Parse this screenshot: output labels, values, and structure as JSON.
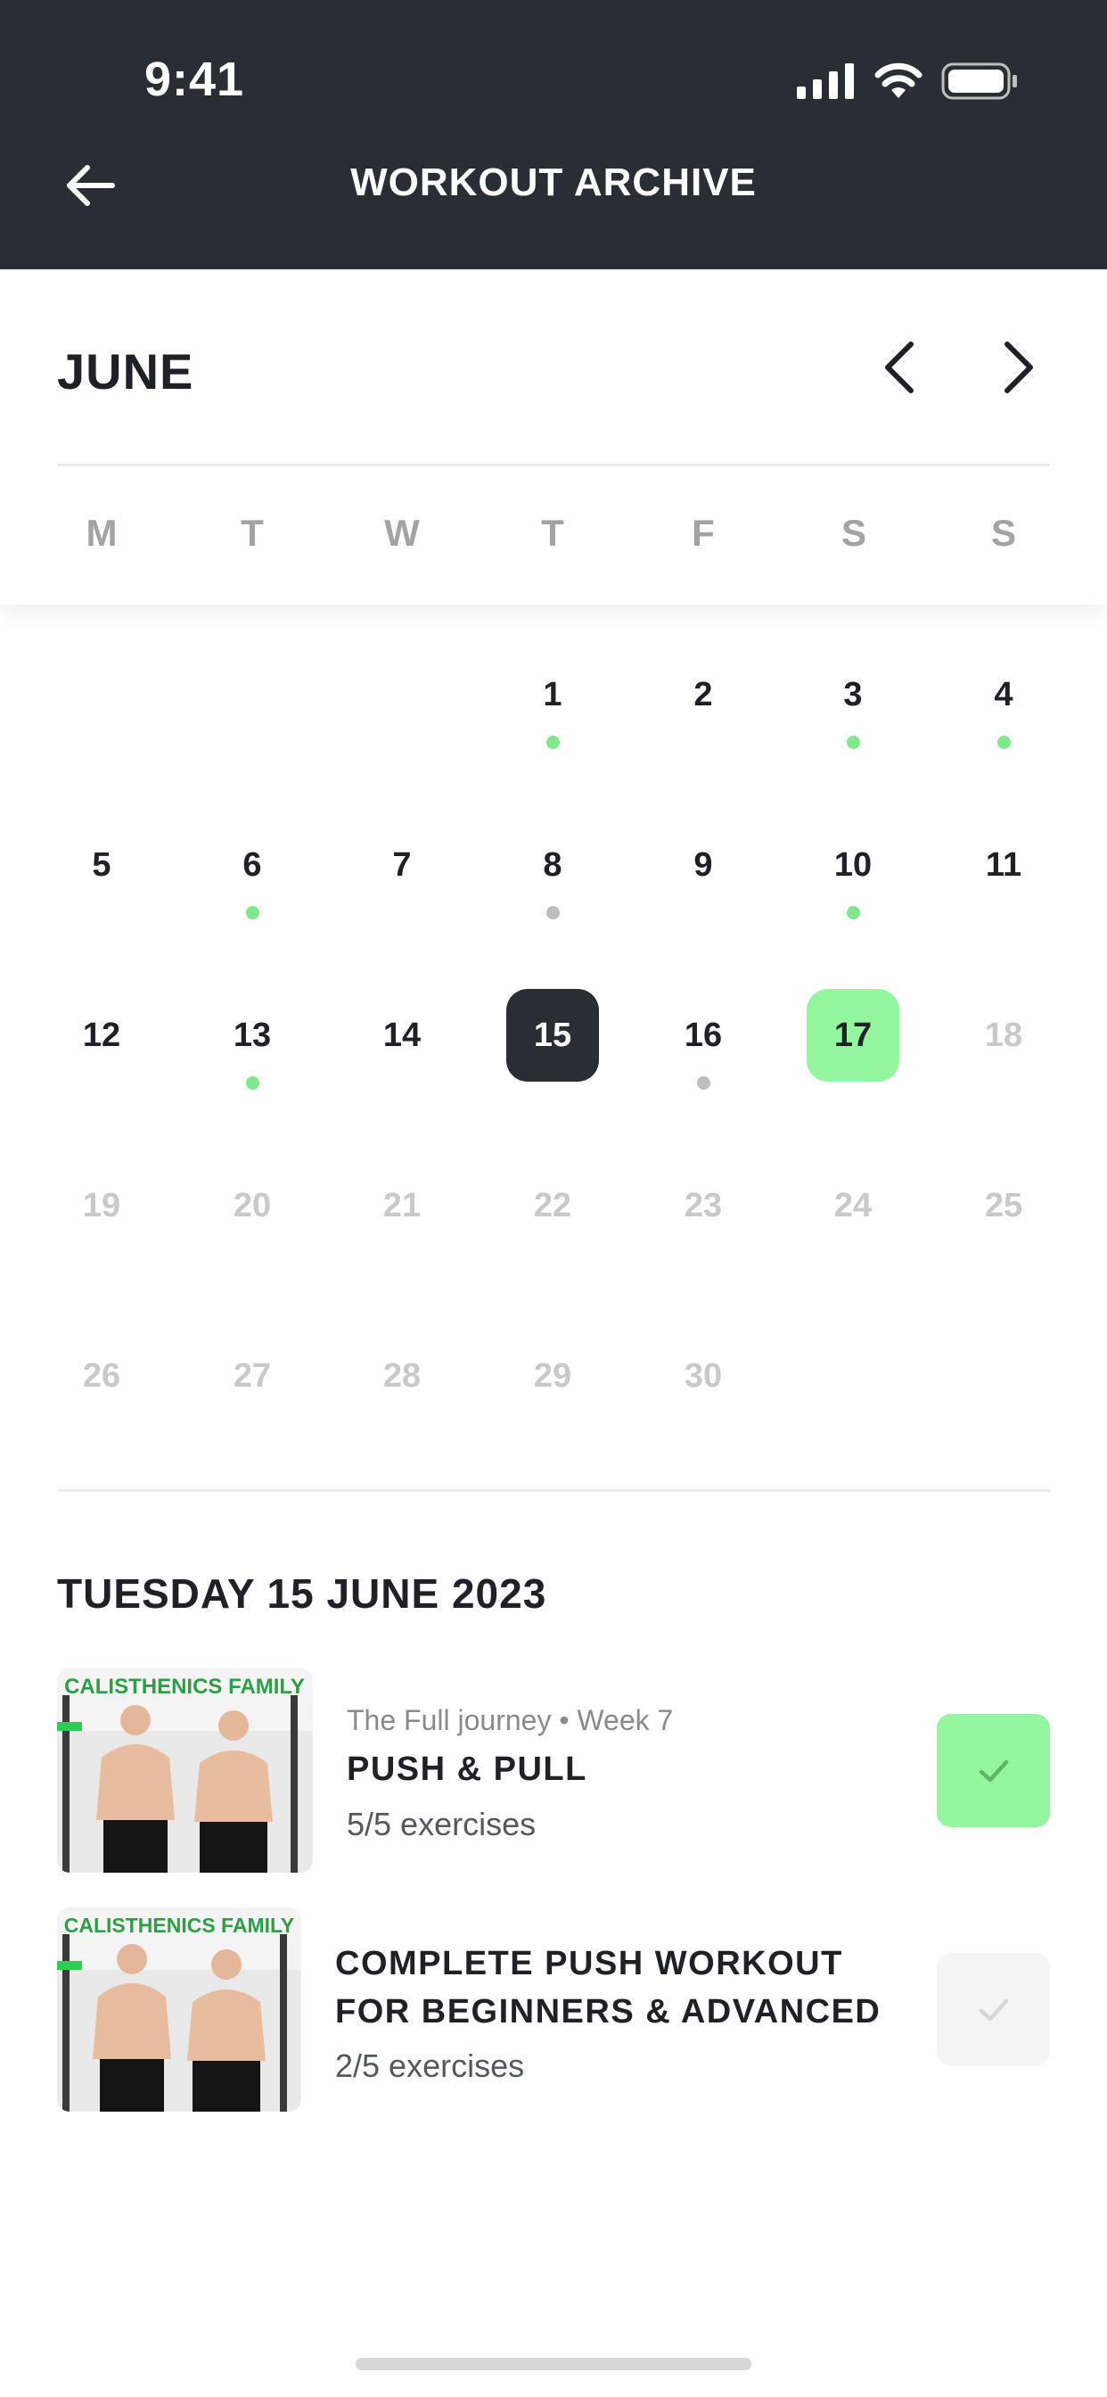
{
  "status_bar": {
    "time": "9:41"
  },
  "header": {
    "title": "WORKOUT ARCHIVE",
    "back_icon": "arrow-left-icon"
  },
  "calendar": {
    "month": "JUNE",
    "weekdays": [
      "M",
      "T",
      "W",
      "T",
      "F",
      "S",
      "S"
    ],
    "selected_day": 15,
    "today": 17,
    "days": [
      {
        "n": "1",
        "col": 3,
        "row": 0,
        "state": "normal",
        "dot": "green"
      },
      {
        "n": "2",
        "col": 4,
        "row": 0,
        "state": "normal",
        "dot": null
      },
      {
        "n": "3",
        "col": 5,
        "row": 0,
        "state": "normal",
        "dot": "green"
      },
      {
        "n": "4",
        "col": 6,
        "row": 0,
        "state": "normal",
        "dot": "green"
      },
      {
        "n": "5",
        "col": 0,
        "row": 1,
        "state": "normal",
        "dot": null
      },
      {
        "n": "6",
        "col": 1,
        "row": 1,
        "state": "normal",
        "dot": "green"
      },
      {
        "n": "7",
        "col": 2,
        "row": 1,
        "state": "normal",
        "dot": null
      },
      {
        "n": "8",
        "col": 3,
        "row": 1,
        "state": "normal",
        "dot": "gray"
      },
      {
        "n": "9",
        "col": 4,
        "row": 1,
        "state": "normal",
        "dot": null
      },
      {
        "n": "10",
        "col": 5,
        "row": 1,
        "state": "normal",
        "dot": "green"
      },
      {
        "n": "11",
        "col": 6,
        "row": 1,
        "state": "normal",
        "dot": null
      },
      {
        "n": "12",
        "col": 0,
        "row": 2,
        "state": "normal",
        "dot": null
      },
      {
        "n": "13",
        "col": 1,
        "row": 2,
        "state": "normal",
        "dot": "green"
      },
      {
        "n": "14",
        "col": 2,
        "row": 2,
        "state": "normal",
        "dot": null
      },
      {
        "n": "15",
        "col": 3,
        "row": 2,
        "state": "selected",
        "dot": null
      },
      {
        "n": "16",
        "col": 4,
        "row": 2,
        "state": "normal",
        "dot": "gray"
      },
      {
        "n": "17",
        "col": 5,
        "row": 2,
        "state": "today",
        "dot": null
      },
      {
        "n": "18",
        "col": 6,
        "row": 2,
        "state": "muted",
        "dot": null
      },
      {
        "n": "19",
        "col": 0,
        "row": 3,
        "state": "muted",
        "dot": null
      },
      {
        "n": "20",
        "col": 1,
        "row": 3,
        "state": "muted",
        "dot": null
      },
      {
        "n": "21",
        "col": 2,
        "row": 3,
        "state": "muted",
        "dot": null
      },
      {
        "n": "22",
        "col": 3,
        "row": 3,
        "state": "muted",
        "dot": null
      },
      {
        "n": "23",
        "col": 4,
        "row": 3,
        "state": "muted",
        "dot": null
      },
      {
        "n": "24",
        "col": 5,
        "row": 3,
        "state": "muted",
        "dot": null
      },
      {
        "n": "25",
        "col": 6,
        "row": 3,
        "state": "muted",
        "dot": null
      },
      {
        "n": "26",
        "col": 0,
        "row": 4,
        "state": "muted",
        "dot": null
      },
      {
        "n": "27",
        "col": 1,
        "row": 4,
        "state": "muted",
        "dot": null
      },
      {
        "n": "28",
        "col": 2,
        "row": 4,
        "state": "muted",
        "dot": null
      },
      {
        "n": "29",
        "col": 3,
        "row": 4,
        "state": "muted",
        "dot": null
      },
      {
        "n": "30",
        "col": 4,
        "row": 4,
        "state": "muted",
        "dot": null
      }
    ]
  },
  "selected_date_label": "TUESDAY 15 JUNE 2023",
  "workouts": [
    {
      "meta": "The Full journey • Week 7",
      "title": "PUSH & PULL",
      "progress": "5/5 exercises",
      "completed": true,
      "thumbnail_text": "CALISTHENICS FAMILY"
    },
    {
      "meta": "",
      "title_line1": "COMPLETE PUSH WORKOUT",
      "title_line2": "FOR BEGINNERS & ADVANCED",
      "progress": "2/5 exercises",
      "completed": false,
      "thumbnail_text": "CALISTHENICS FAMILY"
    }
  ],
  "colors": {
    "header_bg": "#2a2d33",
    "accent_green": "#93f59e",
    "dot_green": "#7ee88a",
    "dot_gray": "#bdbdbd"
  }
}
